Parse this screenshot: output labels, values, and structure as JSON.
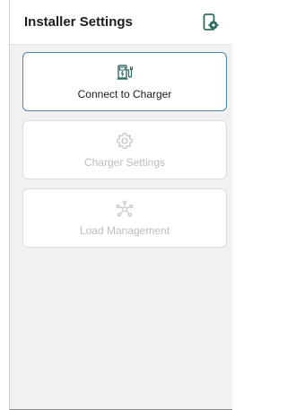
{
  "header": {
    "title": "Installer Settings",
    "settings_icon": "device-settings-icon"
  },
  "menu": [
    {
      "label": "Connect to Charger",
      "icon": "ev-charger-icon",
      "state": "active"
    },
    {
      "label": "Charger Settings",
      "icon": "gear-icon",
      "state": "disabled"
    },
    {
      "label": "Load Management",
      "icon": "network-hub-icon",
      "state": "disabled"
    }
  ],
  "colors": {
    "accent": "#4f86ab",
    "icon_active": "#2f6d63",
    "icon_disabled": "#bdbdbd",
    "background": "#f1f1f1"
  }
}
